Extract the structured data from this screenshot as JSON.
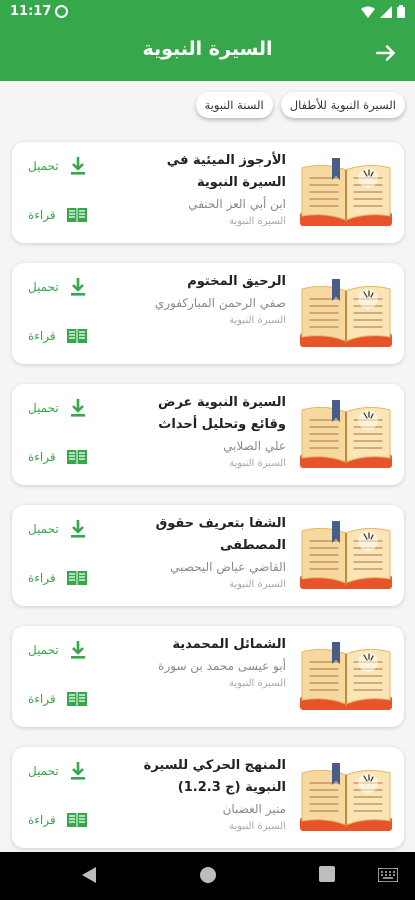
{
  "status_bar": {
    "time": "11:17"
  },
  "app_bar": {
    "title": "السيرة النبوية"
  },
  "chips": [
    {
      "label": "السيرة النبوية للأطفال"
    },
    {
      "label": "السنة النبوية"
    }
  ],
  "actions": {
    "download_label": "تحميل",
    "read_label": "قراءة"
  },
  "books": [
    {
      "title": "الأرجوز الميئية في السيرة النبوية",
      "author": "ابن أبي العز الحنفي",
      "category": "السيرة النبوية"
    },
    {
      "title": "الرحيق المختوم",
      "author": "صفي الرحمن المباركفوري",
      "category": "السيرة النبوية"
    },
    {
      "title": "السيرة النبوية عرض وقائع وتحليل أحداث",
      "author": "علي الصلابي",
      "category": "السيرة النبوية"
    },
    {
      "title": "الشفا بتعريف حقوق المصطفى",
      "author": "القاضي عياض اليحصبي",
      "category": "السيرة النبوية"
    },
    {
      "title": "الشمائل المحمدية",
      "author": "أبو عيسى محمد بن سورة",
      "category": "السيرة النبوية"
    },
    {
      "title": "المنهج الحركي للسيرة النبوية (ج 1.2.3)",
      "author": "منير الغضبان",
      "category": "السيرة النبوية"
    }
  ],
  "colors": {
    "primary": "#36a74b",
    "book_cover": "#e8542a",
    "book_pages": "#f7d9a0"
  }
}
